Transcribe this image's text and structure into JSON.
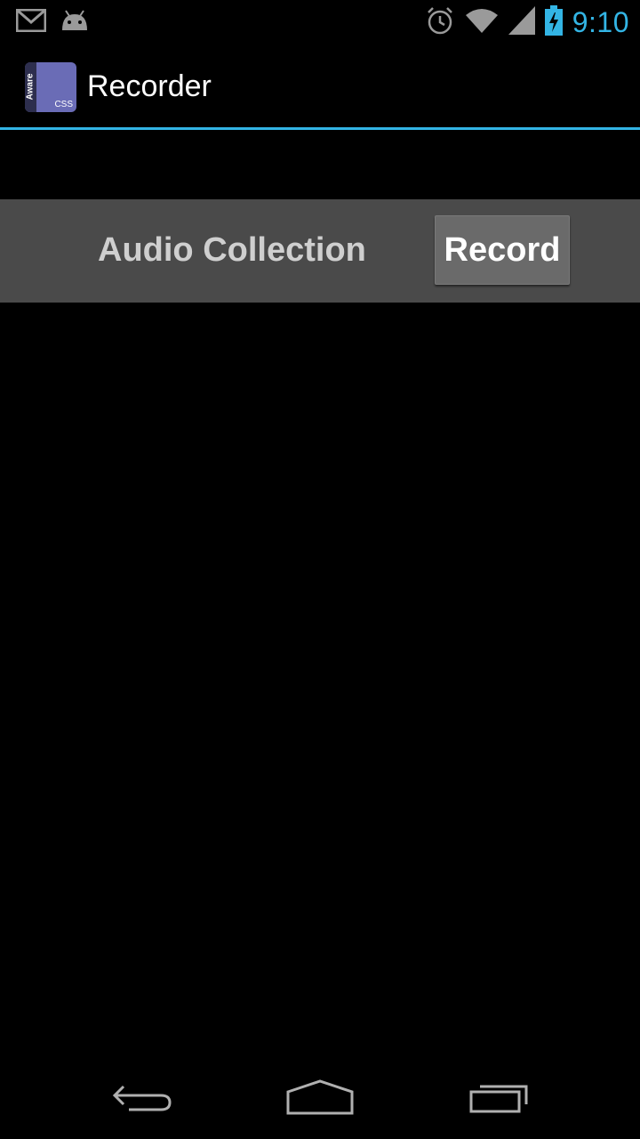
{
  "status_bar": {
    "time": "9:10",
    "icons": [
      "gmail-icon",
      "android-icon",
      "alarm-icon",
      "wifi-icon",
      "signal-icon",
      "battery-charging-icon"
    ]
  },
  "action_bar": {
    "title": "Recorder",
    "app_icon": {
      "top_text": "Aware",
      "bottom_text": "CSS",
      "color": "#6a6cb6"
    },
    "accent_color": "#33b5e5"
  },
  "content": {
    "section_label": "Audio Collection",
    "record_button_label": "Record"
  },
  "nav_bar": {
    "buttons": [
      "back-icon",
      "home-icon",
      "recent-apps-icon"
    ]
  }
}
